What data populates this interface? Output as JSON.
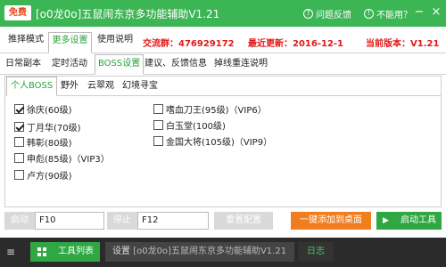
{
  "titlebar": {
    "badge": "免费",
    "title": "[o0龙0o]五鼠闹东京多功能辅助V1.21",
    "help_label": "问题反馈",
    "unavailable_label": "不能用？",
    "minimize": "−",
    "close": "×"
  },
  "main_tabs": [
    "推择模式",
    "更多设置",
    "使用说明"
  ],
  "info": {
    "qq_group": "交流群：476929172",
    "last_update": "最近更新：2016-12-1",
    "current_version": "当前版本：V1.21"
  },
  "sub_tabs": [
    "日常副本",
    "定时活动",
    "BOSS设置",
    "建议、反馈信息",
    "掉线重连说明"
  ],
  "boss_tabs": [
    "个人BOSS",
    "野外",
    "云翠观",
    "幻境寻宝"
  ],
  "bosses_left": [
    {
      "label": "徐庆(60级)",
      "checked": true
    },
    {
      "label": "丁月华(70级)",
      "checked": true
    },
    {
      "label": "韩彰(80级)",
      "checked": false
    },
    {
      "label": "申彪(85级)（VIP3）",
      "checked": false
    },
    {
      "label": "卢方(90级)",
      "checked": false
    }
  ],
  "bosses_right": [
    {
      "label": "嗜血刀王(95级)（VIP6）",
      "checked": false
    },
    {
      "label": "白玉堂(100级)",
      "checked": false
    },
    {
      "label": "金国大将(105级)（VIP9）",
      "checked": false
    }
  ],
  "controls": {
    "start_label": "启动",
    "start_hotkey": "F10",
    "stop_label": "停止",
    "stop_hotkey": "F12",
    "reset_label": "重置配置",
    "add_desktop_label": "一键添加到桌面",
    "launch_tool_label": "启动工具"
  },
  "taskbar": {
    "menu_icon": "≡",
    "tools_label": "工具列表",
    "window_setting": "设置",
    "window_title": "[o0龙0o]五鼠闹东京多功能辅助V1.21",
    "log_label": "日志"
  },
  "colors": {
    "accent_green": "#3cb554",
    "button_green": "#2fa844",
    "button_orange": "#f07e1e",
    "info_red": "#e01818",
    "taskbar_dark": "#2b2b2b"
  }
}
